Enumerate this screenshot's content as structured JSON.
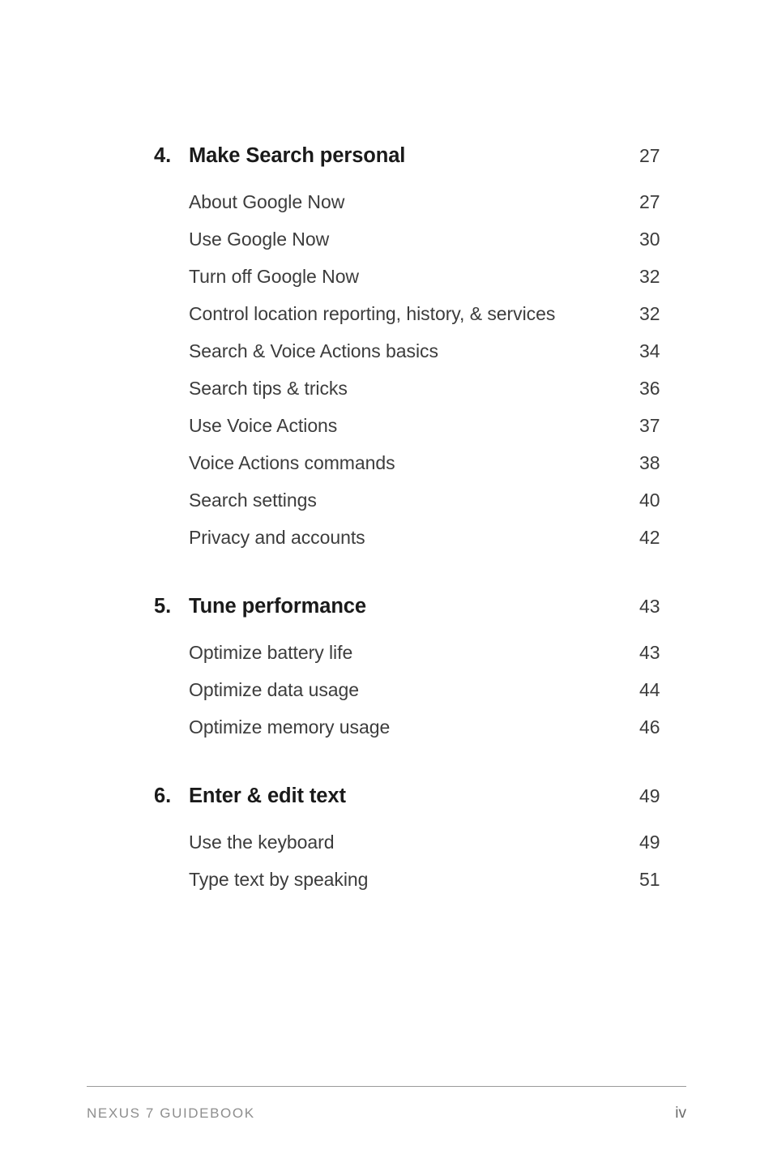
{
  "document": {
    "kind": "table-of-contents"
  },
  "toc": {
    "groups": [
      {
        "number": "4.",
        "title": "Make Search personal",
        "page": "27",
        "entries": [
          {
            "label": "About Google Now",
            "page": "27"
          },
          {
            "label": "Use Google Now",
            "page": "30"
          },
          {
            "label": "Turn off Google Now",
            "page": "32"
          },
          {
            "label": "Control location reporting, history, & services",
            "page": "32"
          },
          {
            "label": "Search & Voice Actions basics",
            "page": "34"
          },
          {
            "label": "Search tips & tricks",
            "page": "36"
          },
          {
            "label": "Use Voice Actions",
            "page": "37"
          },
          {
            "label": "Voice Actions commands",
            "page": "38"
          },
          {
            "label": "Search settings",
            "page": "40"
          },
          {
            "label": "Privacy and accounts",
            "page": "42"
          }
        ]
      },
      {
        "number": "5.",
        "title": "Tune performance",
        "page": "43",
        "entries": [
          {
            "label": "Optimize battery life",
            "page": "43"
          },
          {
            "label": "Optimize data usage",
            "page": "44"
          },
          {
            "label": "Optimize memory usage",
            "page": "46"
          }
        ]
      },
      {
        "number": "6.",
        "title": "Enter & edit text",
        "page": "49",
        "entries": [
          {
            "label": "Use the keyboard",
            "page": "49"
          },
          {
            "label": "Type text by speaking",
            "page": "51"
          }
        ]
      }
    ]
  },
  "footer": {
    "title": "NEXUS 7 GUIDEBOOK",
    "page_number": "iv"
  },
  "colors": {
    "background": "#ffffff",
    "heading_text": "#1a1a1a",
    "entry_text": "#3c3c3c",
    "footer_text": "#8e8e8e",
    "footer_rule": "#9a9a9a"
  }
}
